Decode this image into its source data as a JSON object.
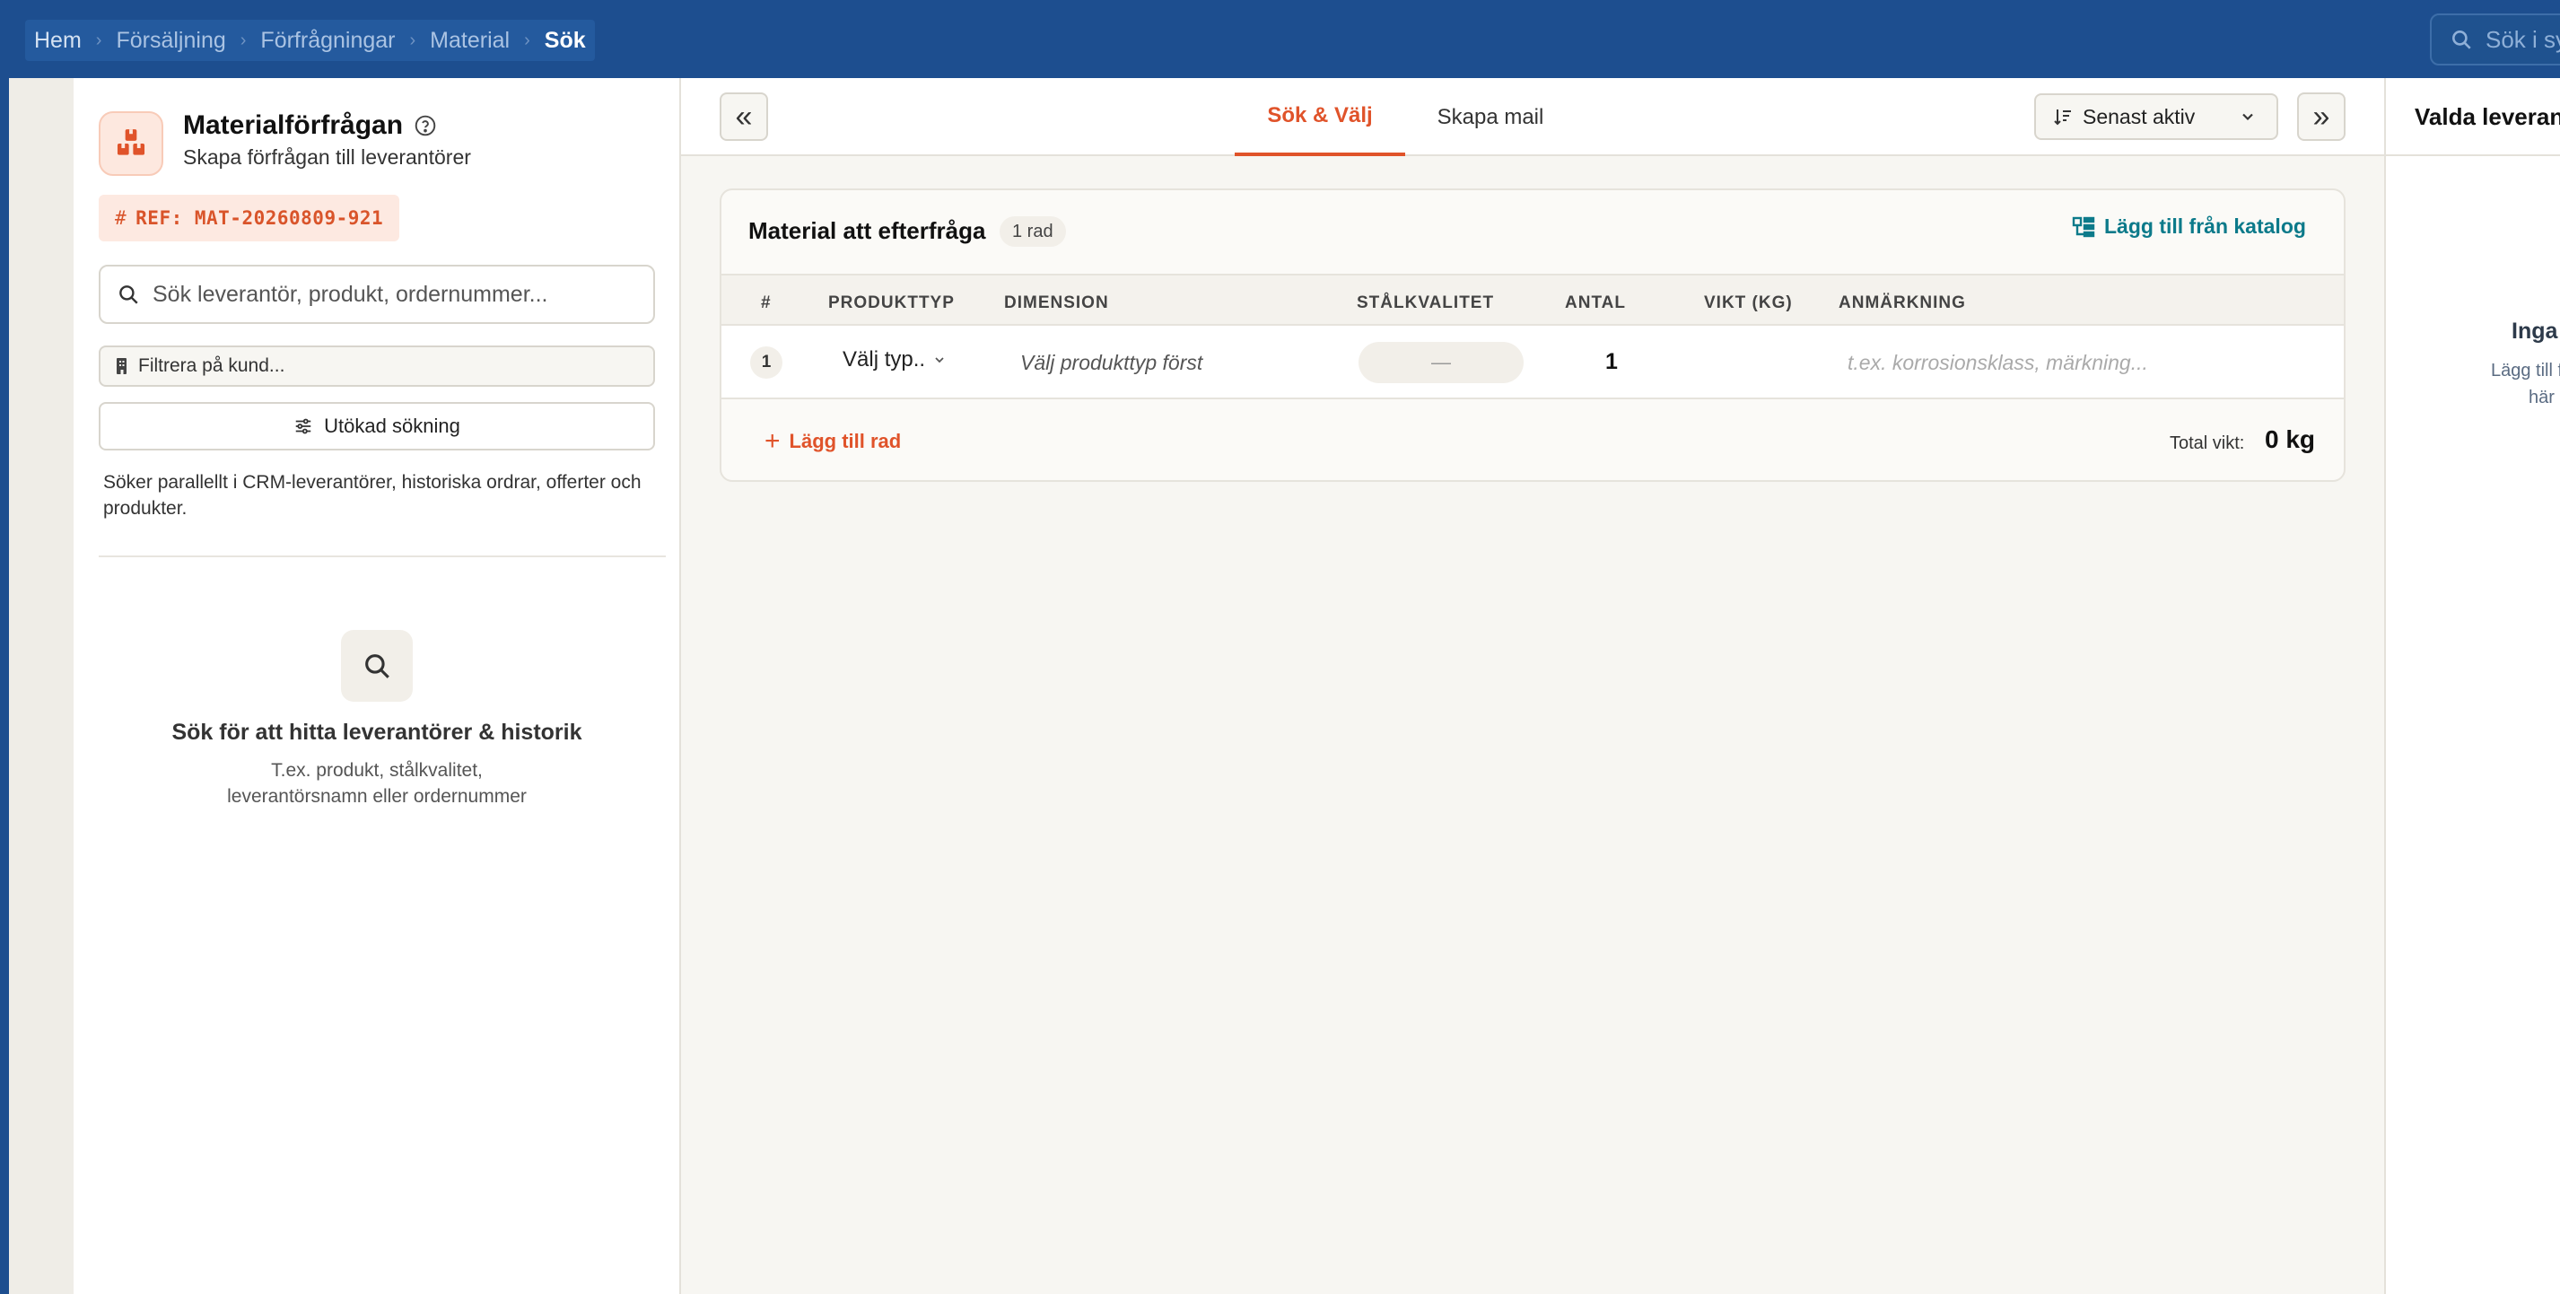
{
  "breadcrumb": [
    "Hem",
    "Försäljning",
    "Förfrågningar",
    "Material",
    "Sök"
  ],
  "global_search": {
    "placeholder": "Sök i sy"
  },
  "left": {
    "title": "Materialförfrågan",
    "subtitle": "Skapa förfrågan till leverantörer",
    "ref": "REF: MAT-20260809-921",
    "search_placeholder": "Sök leverantör, produkt, ordernummer...",
    "filter_placeholder": "Filtrera på kund...",
    "advanced_label": "Utökad sökning",
    "hint": "Söker parallellt i CRM-leverantörer, historiska ordrar, offerter och produkter.",
    "empty_title": "Sök för att hitta leverantörer & historik",
    "empty_sub": "T.ex. produkt, stålkvalitet, leverantörsnamn eller ordernummer"
  },
  "center": {
    "tabs": [
      "Sök & Välj",
      "Skapa mail"
    ],
    "sort_label": "Senast aktiv",
    "collapse_left": "«",
    "collapse_right": "»",
    "card_title": "Material att efterfråga",
    "row_count": "1 rad",
    "catalog_link": "Lägg till från katalog",
    "columns": [
      "#",
      "PRODUKTTYP",
      "DIMENSION",
      "STÅLKVALITET",
      "ANTAL",
      "VIKT (KG)",
      "ANMÄRKNING"
    ],
    "rows": [
      {
        "num": "1",
        "type": "Välj typ..",
        "dimension": "Välj produkttyp först",
        "steel": "—",
        "qty": "1",
        "weight": "",
        "note_placeholder": "t.ex. korrosionsklass, märkning..."
      }
    ],
    "add_row": "Lägg till rad",
    "total_label": "Total vikt:",
    "total_value": "0 kg"
  },
  "right": {
    "title": "Valda leverant",
    "empty_title": "Inga",
    "empty_sub1": "Lägg till frå",
    "empty_sub2": "här i"
  },
  "colors": {
    "topbar": "#1d4e8f",
    "accent": "#e0532a",
    "link": "#0c7a8a"
  }
}
